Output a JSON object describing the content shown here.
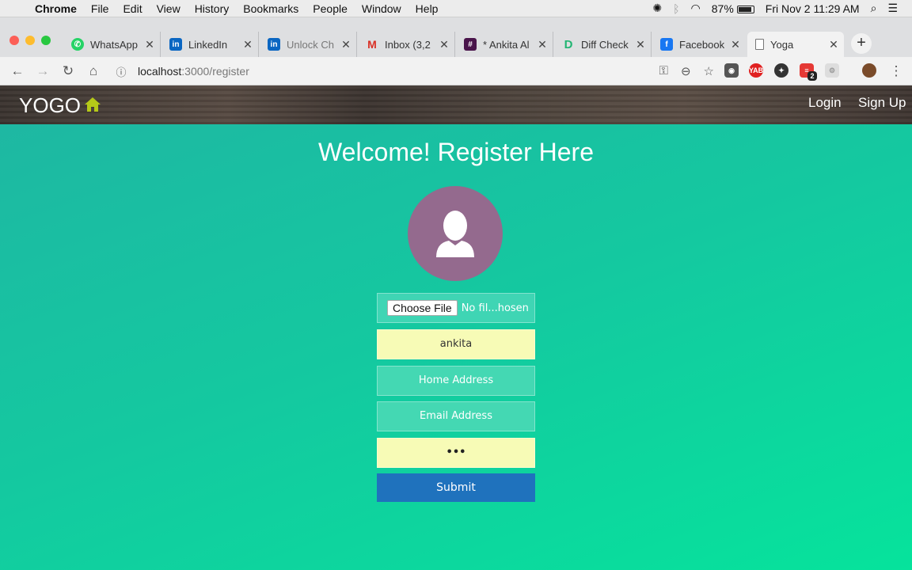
{
  "menubar": {
    "app": "Chrome",
    "items": [
      "File",
      "Edit",
      "View",
      "History",
      "Bookmarks",
      "People",
      "Window",
      "Help"
    ],
    "battery": "87%",
    "datetime": "Fri Nov 2  11:29 AM"
  },
  "tabs": [
    {
      "title": "WhatsApp",
      "icon": "whatsapp-icon"
    },
    {
      "title": "LinkedIn",
      "icon": "linkedin-icon"
    },
    {
      "title": "Unlock Ch",
      "icon": "linkedin-icon"
    },
    {
      "title": "Inbox (3,2",
      "icon": "gmail-icon"
    },
    {
      "title": "* Ankita Al",
      "icon": "slack-icon"
    },
    {
      "title": "Diff Check",
      "icon": "diffchecker-icon"
    },
    {
      "title": "Facebook",
      "icon": "facebook-icon"
    },
    {
      "title": "Yoga",
      "icon": "page-icon"
    }
  ],
  "address": {
    "host": "localhost",
    "path": ":3000/register"
  },
  "extensions": {
    "yab_label": "YAB",
    "badge_count": "2"
  },
  "site": {
    "brand": "YOGO",
    "nav": {
      "login": "Login",
      "signup": "Sign Up"
    },
    "heading": "Welcome! Register Here",
    "file_button": "Choose File",
    "file_status": "No fil...hosen",
    "name_value": "ankita",
    "address_placeholder": "Home Address",
    "email_placeholder": "Email Address",
    "password_mask": "•••",
    "submit_label": "Submit"
  },
  "colors": {
    "home_icon": "#b5c918",
    "avatar_bg": "#946a8e",
    "submit_bg": "#1f72bd",
    "page_gradient_start": "#1fb6a3",
    "page_gradient_end": "#06e39c"
  }
}
